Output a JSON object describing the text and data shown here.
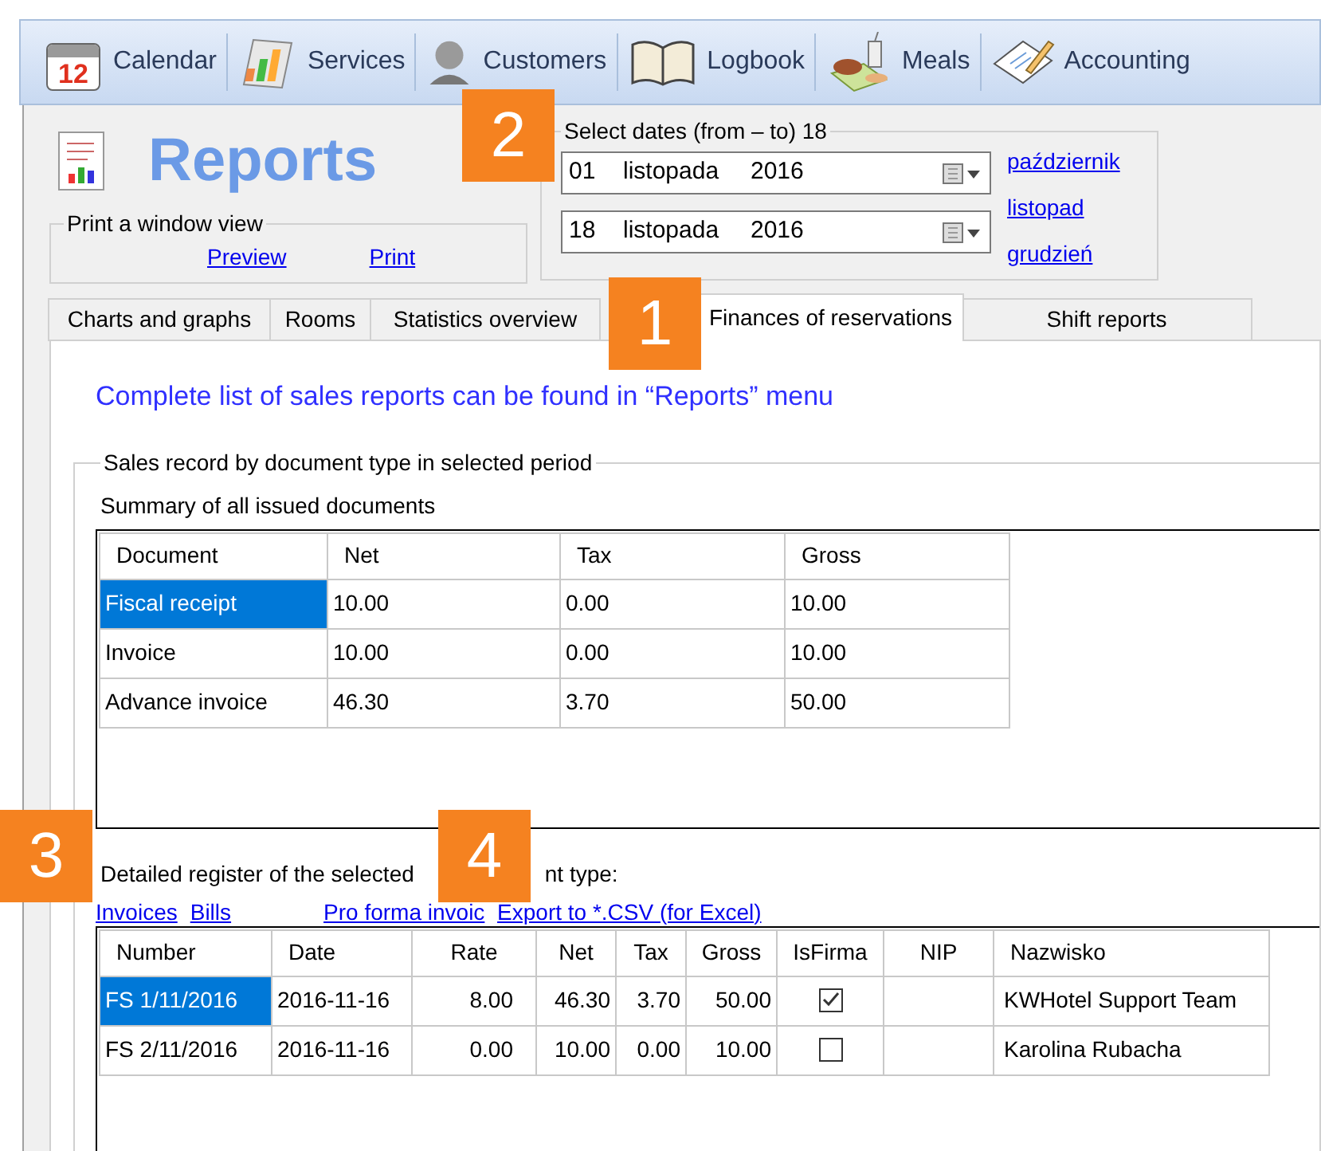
{
  "toolbar": {
    "items": [
      {
        "kind": "calendar",
        "label": "Calendar",
        "icon_text": "12"
      },
      {
        "kind": "services",
        "label": "Services"
      },
      {
        "kind": "customers",
        "label": "Customers"
      },
      {
        "kind": "logbook",
        "label": "Logbook"
      },
      {
        "kind": "meals",
        "label": "Meals"
      },
      {
        "kind": "accounting",
        "label": "Accounting"
      }
    ]
  },
  "header": {
    "title": "Reports",
    "print_group": {
      "title": "Print a window view",
      "links": [
        "Preview",
        "Print"
      ]
    }
  },
  "date_range": {
    "title": "Select dates (from – to) 18",
    "fields": [
      {
        "day": "01",
        "month": "listopada",
        "year": "2016"
      },
      {
        "day": "18",
        "month": "listopada",
        "year": "2016"
      }
    ],
    "month_links": [
      "październik",
      "listopad",
      "grudzień"
    ]
  },
  "tabs": [
    {
      "label": "Charts and graphs",
      "selected": false
    },
    {
      "label": "Rooms",
      "selected": false
    },
    {
      "label": "Statistics overview",
      "selected": false
    },
    {
      "label": "Finances of reservations",
      "selected": true
    },
    {
      "label": "Shift reports",
      "selected": false
    }
  ],
  "notice": "Complete list of sales reports can be found in “Reports” menu",
  "sales_group": {
    "title": "Sales record by document type in selected period",
    "summary_title": "Summary of all issued documents",
    "summary_table": {
      "columns": [
        "Document",
        "Net",
        "Tax",
        "Gross"
      ],
      "rows": [
        {
          "cells": [
            "Fiscal receipt",
            "10.00",
            "0.00",
            "10.00"
          ],
          "selected": true
        },
        {
          "cells": [
            "Invoice",
            "10.00",
            "0.00",
            "10.00"
          ],
          "selected": false
        },
        {
          "cells": [
            "Advance invoice",
            "46.30",
            "3.70",
            "50.00"
          ],
          "selected": false
        }
      ]
    },
    "register_title_parts": [
      "Detailed register of the selected",
      "nt type:"
    ],
    "register_links": [
      "Invoices",
      "Bills",
      "Pro forma invoic",
      "Export to *.CSV (for Excel)"
    ],
    "register_table": {
      "columns": [
        "Number",
        "Date",
        "Rate",
        "Net",
        "Tax",
        "Gross",
        "IsFirma",
        "NIP",
        "Nazwisko"
      ],
      "rows": [
        {
          "number": "FS 1/11/2016",
          "date": "2016-11-16",
          "rate": "8.00",
          "net": "46.30",
          "tax": "3.70",
          "gross": "50.00",
          "is_firma": true,
          "nazwisko": "KWHotel Support Team",
          "selected": true
        },
        {
          "number": "FS 2/11/2016",
          "date": "2016-11-16",
          "rate": "0.00",
          "net": "10.00",
          "tax": "0.00",
          "gross": "10.00",
          "is_firma": false,
          "nazwisko": "Karolina Rubacha",
          "selected": false
        }
      ]
    }
  },
  "callouts": [
    "1",
    "2",
    "3",
    "4"
  ]
}
